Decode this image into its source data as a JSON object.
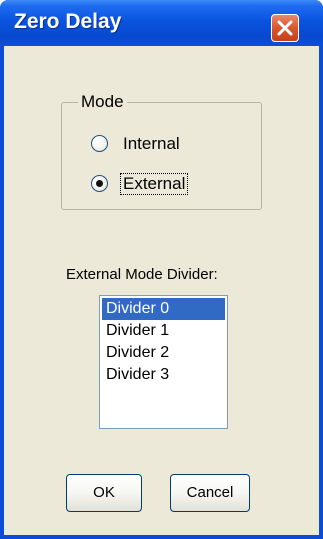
{
  "window": {
    "title": "Zero Delay"
  },
  "mode_group": {
    "legend": "Mode",
    "options": [
      {
        "label": "Internal",
        "selected": false
      },
      {
        "label": "External",
        "selected": true
      }
    ]
  },
  "divider": {
    "label": "External Mode Divider:",
    "items": [
      "Divider 0",
      "Divider 1",
      "Divider 2",
      "Divider 3"
    ],
    "selected": "Divider 0"
  },
  "buttons": {
    "ok": "OK",
    "cancel": "Cancel"
  },
  "colors": {
    "titlebar": "#0a54df",
    "close_button": "#d8562e",
    "selection": "#316ac5",
    "dialog_face": "#ece9d8"
  },
  "icons": {
    "close": "close-icon"
  }
}
